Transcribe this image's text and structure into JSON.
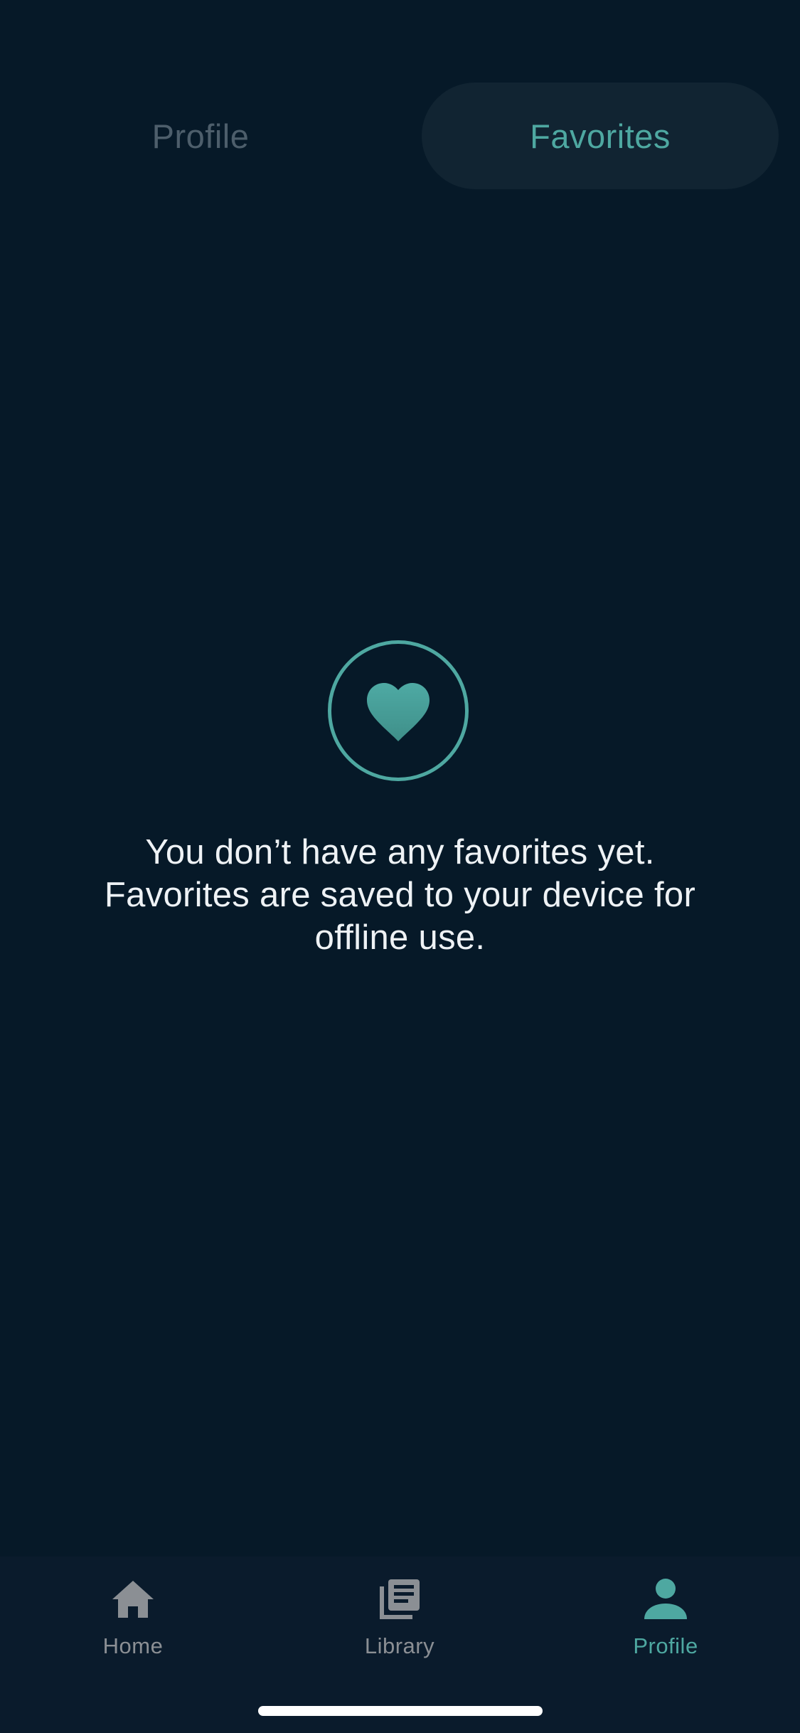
{
  "segmented_tabs": {
    "items": [
      {
        "label": "Profile",
        "selected": false
      },
      {
        "label": "Favorites",
        "selected": true
      }
    ]
  },
  "empty_state": {
    "icon": "heart-icon",
    "message_lines": [
      "You don’t have any favorites yet.",
      "Favorites are saved to your device for",
      "offline use."
    ]
  },
  "tabbar": {
    "items": [
      {
        "label": "Home",
        "icon": "home-icon",
        "active": false
      },
      {
        "label": "Library",
        "icon": "library-icon",
        "active": false
      },
      {
        "label": "Profile",
        "icon": "person-icon",
        "active": true
      }
    ]
  },
  "colors": {
    "background": "#061928",
    "accent": "#4ea8a1",
    "tab_selected_bg": "#112432",
    "tab_inactive_text": "#4d5e6b",
    "tabbar_bg": "#0a1b2c",
    "tabbar_inactive": "#8b8f94",
    "message_text": "#eef2f5"
  }
}
